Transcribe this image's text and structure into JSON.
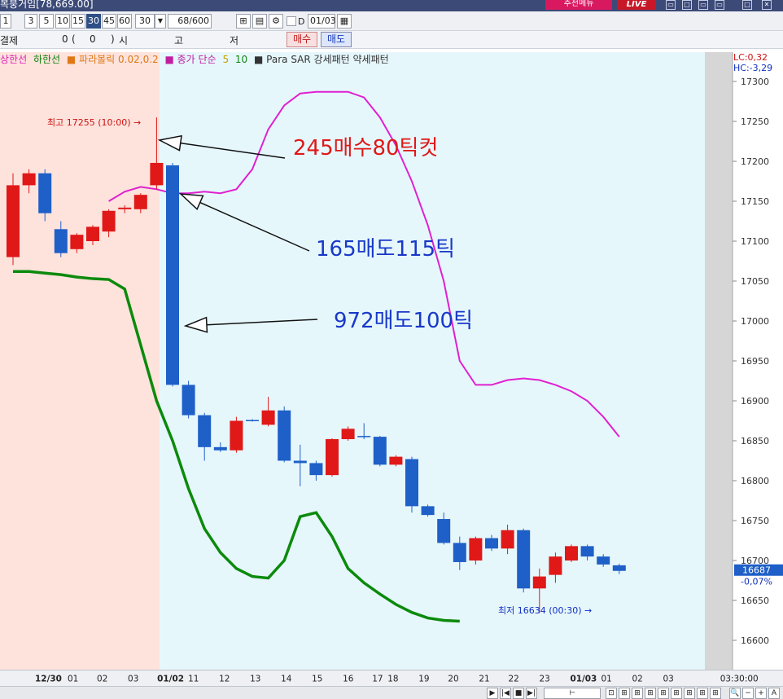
{
  "window": {
    "title": "복붕거임[78,669.00]",
    "recommend_label": "추천메뉴",
    "live_label": "LIVE",
    "controls": [
      "▭",
      "□",
      "▭",
      "▭",
      "□",
      "✕"
    ]
  },
  "toolbar": {
    "periods": [
      "1",
      "3",
      "5",
      "10",
      "15",
      "30",
      "45",
      "60"
    ],
    "active_period": "30",
    "period_select_value": "30",
    "count_value": "68",
    "count_total": "/600",
    "date_value": "01/03",
    "checkbox_label": "D"
  },
  "order_bar": {
    "label_settle": "결제",
    "value_qty": "0",
    "paren_open": "(",
    "paren_value": "0",
    "paren_close": ")",
    "label_open": "시",
    "label_high": "고",
    "label_low": "저",
    "buy_label": "매수",
    "sell_label": "매도"
  },
  "legend": {
    "items": [
      {
        "text": "상한선",
        "color": "#e020b8"
      },
      {
        "text": "하한선",
        "color": "#108010"
      },
      {
        "text": "■ 파라볼릭 0.02,0.2",
        "color": "#e07818"
      },
      {
        "text": "■ 종가 단순",
        "color": "#c020a0"
      },
      {
        "text": "5",
        "color": "#c8a000"
      },
      {
        "text": "10",
        "color": "#108010"
      },
      {
        "text": "■ Para SAR 강세패턴  약세패턴",
        "color": "#333333"
      }
    ]
  },
  "price_info": {
    "lc": "LC:0,32",
    "hc": "HC:-3,29",
    "current_price": "16687",
    "current_change": "-0,07%"
  },
  "chart_data": {
    "type": "candlestick",
    "ylim": [
      16580,
      17320
    ],
    "y_ticks": [
      16600,
      16650,
      16700,
      16750,
      16800,
      16850,
      16900,
      16950,
      17000,
      17050,
      17100,
      17150,
      17200,
      17250,
      17300
    ],
    "x_labels": [
      "12/30",
      "01",
      "02",
      "03",
      "01/02",
      "11",
      "12",
      "13",
      "14",
      "15",
      "16",
      "17",
      "18",
      "19",
      "20",
      "21",
      "22",
      "23",
      "01/03",
      "01",
      "02",
      "03"
    ],
    "time_label": "03:30:00",
    "candles": [
      {
        "o": 17080,
        "h": 17185,
        "l": 17070,
        "c": 17170
      },
      {
        "o": 17170,
        "h": 17190,
        "l": 17160,
        "c": 17185
      },
      {
        "o": 17185,
        "h": 17190,
        "l": 17125,
        "c": 17135
      },
      {
        "o": 17115,
        "h": 17125,
        "l": 17080,
        "c": 17085
      },
      {
        "o": 17090,
        "h": 17110,
        "l": 17085,
        "c": 17108
      },
      {
        "o": 17100,
        "h": 17120,
        "l": 17095,
        "c": 17118
      },
      {
        "o": 17112,
        "h": 17140,
        "l": 17105,
        "c": 17138
      },
      {
        "o": 17140,
        "h": 17145,
        "l": 17135,
        "c": 17142
      },
      {
        "o": 17140,
        "h": 17160,
        "l": 17135,
        "c": 17158
      },
      {
        "o": 17170,
        "h": 17255,
        "l": 17165,
        "c": 17198
      },
      {
        "o": 17195,
        "h": 17198,
        "l": 16918,
        "c": 16920
      },
      {
        "o": 16920,
        "h": 16925,
        "l": 16878,
        "c": 16882
      },
      {
        "o": 16882,
        "h": 16885,
        "l": 16825,
        "c": 16842
      },
      {
        "o": 16842,
        "h": 16848,
        "l": 16836,
        "c": 16838
      },
      {
        "o": 16838,
        "h": 16880,
        "l": 16835,
        "c": 16875
      },
      {
        "o": 16876,
        "h": 16877,
        "l": 16874,
        "c": 16875
      },
      {
        "o": 16870,
        "h": 16905,
        "l": 16868,
        "c": 16888
      },
      {
        "o": 16888,
        "h": 16893,
        "l": 16823,
        "c": 16825
      },
      {
        "o": 16825,
        "h": 16845,
        "l": 16793,
        "c": 16822
      },
      {
        "o": 16822,
        "h": 16825,
        "l": 16800,
        "c": 16807
      },
      {
        "o": 16807,
        "h": 16853,
        "l": 16805,
        "c": 16852
      },
      {
        "o": 16852,
        "h": 16868,
        "l": 16850,
        "c": 16865
      },
      {
        "o": 16856,
        "h": 16872,
        "l": 16852,
        "c": 16855
      },
      {
        "o": 16855,
        "h": 16856,
        "l": 16818,
        "c": 16820
      },
      {
        "o": 16820,
        "h": 16832,
        "l": 16818,
        "c": 16830
      },
      {
        "o": 16827,
        "h": 16830,
        "l": 16760,
        "c": 16768
      },
      {
        "o": 16768,
        "h": 16770,
        "l": 16755,
        "c": 16757
      },
      {
        "o": 16752,
        "h": 16760,
        "l": 16720,
        "c": 16722
      },
      {
        "o": 16722,
        "h": 16730,
        "l": 16688,
        "c": 16698
      },
      {
        "o": 16700,
        "h": 16730,
        "l": 16695,
        "c": 16728
      },
      {
        "o": 16728,
        "h": 16732,
        "l": 16712,
        "c": 16715
      },
      {
        "o": 16715,
        "h": 16745,
        "l": 16708,
        "c": 16738
      },
      {
        "o": 16738,
        "h": 16740,
        "l": 16660,
        "c": 16665
      },
      {
        "o": 16665,
        "h": 16690,
        "l": 16634,
        "c": 16680
      },
      {
        "o": 16682,
        "h": 16710,
        "l": 16672,
        "c": 16705
      },
      {
        "o": 16700,
        "h": 16720,
        "l": 16698,
        "c": 16718
      },
      {
        "o": 16718,
        "h": 16720,
        "l": 16700,
        "c": 16705
      },
      {
        "o": 16705,
        "h": 16708,
        "l": 16692,
        "c": 16695
      },
      {
        "o": 16694,
        "h": 16696,
        "l": 16683,
        "c": 16687
      }
    ],
    "lines": {
      "upper_band": [
        17150,
        17162,
        17168,
        17165,
        17160,
        17160,
        17162,
        17160,
        17165,
        17190,
        17240,
        17270,
        17285,
        17287,
        17287,
        17287,
        17280,
        17255,
        17220,
        17175,
        17120,
        17050,
        16950,
        16920,
        16920,
        16926,
        16928,
        16926,
        16920,
        16912,
        16900,
        16880,
        16855
      ],
      "lower_band": [
        17062,
        17062,
        17060,
        17058,
        17055,
        17053,
        17052,
        17040,
        16970,
        16900,
        16850,
        16790,
        16740,
        16710,
        16690,
        16680,
        16678,
        16700,
        16755,
        16760,
        16730,
        16690,
        16672,
        16658,
        16645,
        16635,
        16628,
        16625,
        16624
      ]
    },
    "annotations": [
      {
        "text": "최고 17255 (10:00) →",
        "color": "#d01010"
      },
      {
        "text": "최저 16634 (00:30) →",
        "color": "#1030c0"
      },
      {
        "text": "245매수80틱컷",
        "color": "#e01818"
      },
      {
        "text": "165매도115틱",
        "color": "#1838c8"
      },
      {
        "text": "972매도100틱",
        "color": "#1838c8"
      }
    ]
  },
  "scrollbar": {
    "buttons": [
      "▶",
      "|◀",
      "■",
      "▶|",
      "⊢",
      "⊡",
      "⊞",
      "⊞",
      "⊞",
      "⊞",
      "⊞",
      "⊞",
      "⊞",
      "⊞",
      "⊞",
      "⊞",
      "⊞",
      "🔍",
      "−",
      "+",
      "A"
    ]
  }
}
